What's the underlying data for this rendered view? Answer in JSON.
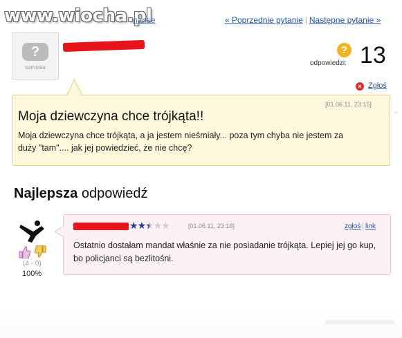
{
  "watermark": {
    "text": "www.wiocha.pl",
    "partial_link": "nanse"
  },
  "nav": {
    "previous": "« Poprzednie pytanie",
    "separator": "|",
    "next": "Następne pytanie »"
  },
  "avatar": {
    "wordmark": "samosia"
  },
  "answers": {
    "label": "odpowiedzi:",
    "count": "13",
    "icon": "question-icon"
  },
  "question": {
    "report": "Zgłoś",
    "date": "[01.06.11, 23:15]",
    "title": "Moja dziewczyna chce trójkąta!!",
    "body": "Moja dziewczyna chce trójkąta, a ja jestem nieśmiały... poza tym chyba nie jestem za duży \"tam\".... jak jej powiedzieć, że nie chcę?"
  },
  "best_answer": {
    "heading_bold": "Najlepsza",
    "heading_rest": " odpowiedź",
    "rating": 2.5,
    "date": "[01.06.11, 23:18]",
    "report": "zgłoś",
    "link": "link",
    "link_separator": "|",
    "votes": "(4 - 0)",
    "percent": "100%",
    "body": "Ostatnio dostałam mandat właśnie za nie posiadanie trójkąta. Lepiej jej go kup, bo policjanci są bezlitośni."
  },
  "colors": {
    "redaction": "#e8141c",
    "question_bg": "#fdf7dc",
    "answer_bg": "#fdf2f3",
    "link": "#2255aa"
  }
}
